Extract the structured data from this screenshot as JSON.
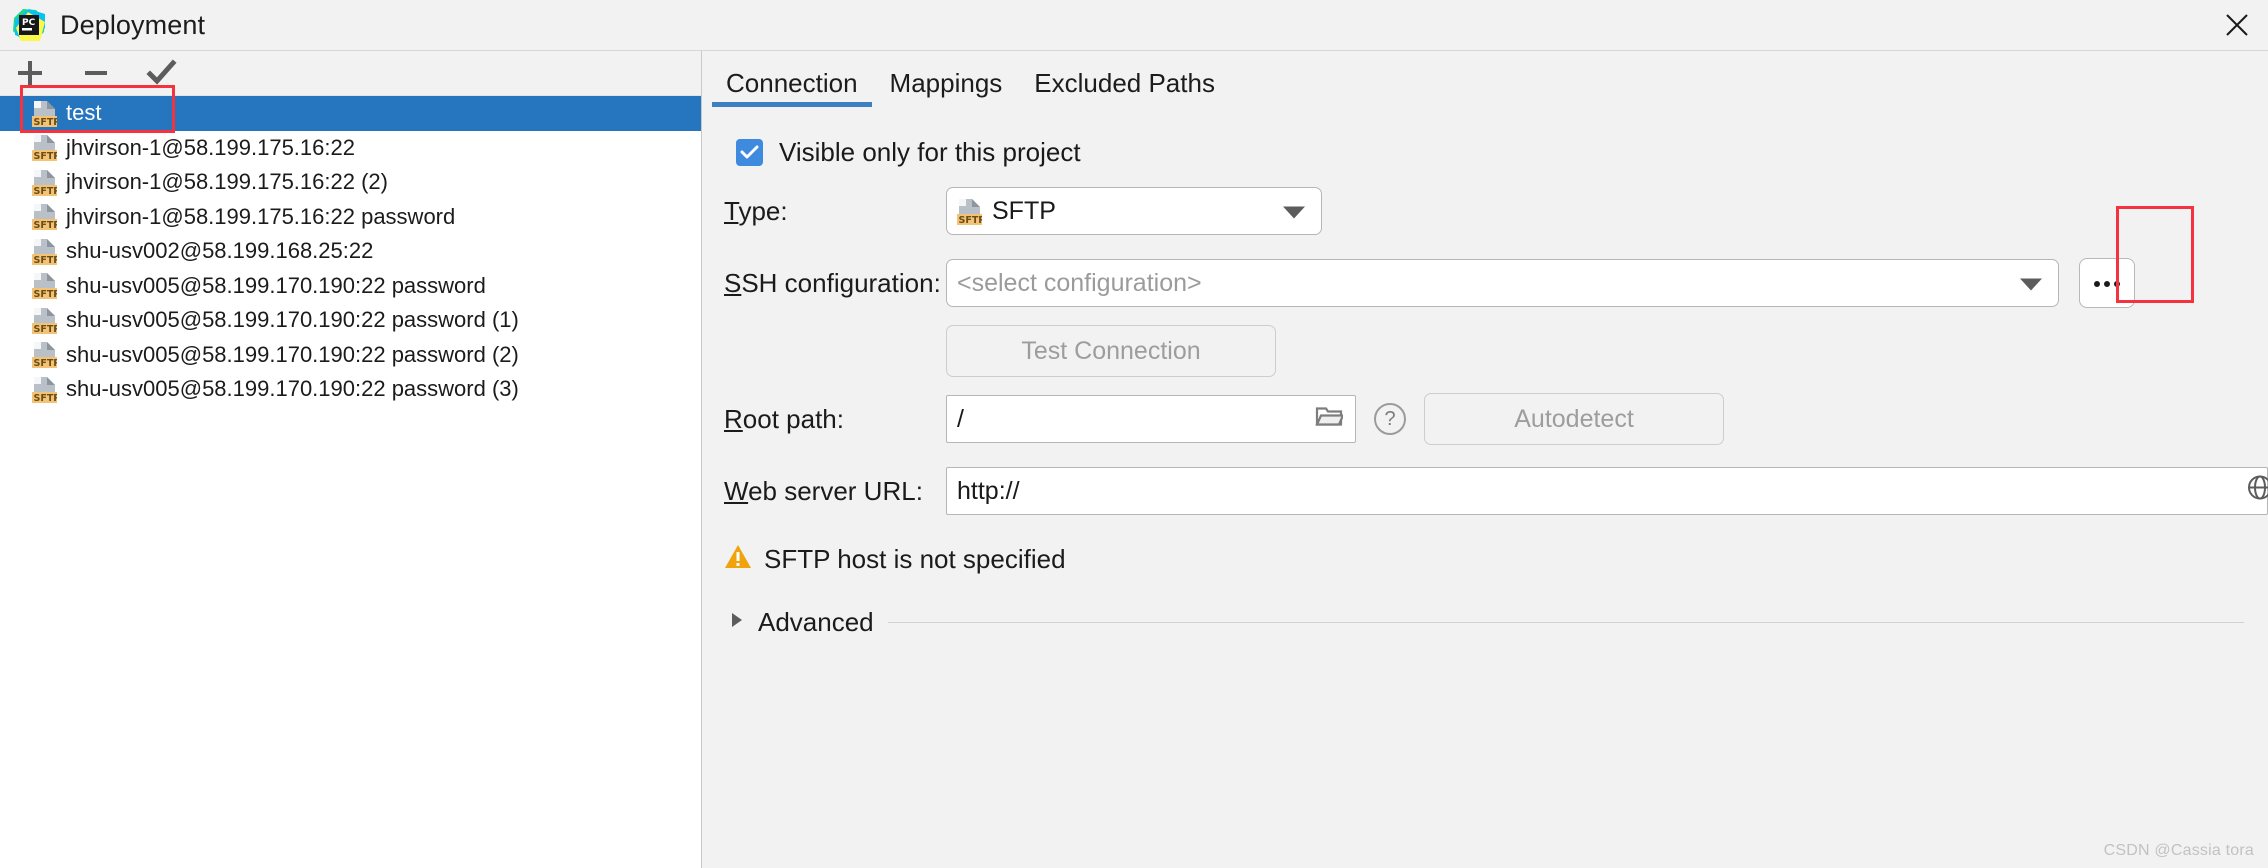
{
  "window": {
    "title": "Deployment",
    "logo_icon": "pycharm-logo-icon",
    "close_icon": "close-icon"
  },
  "toolbar": {
    "add_label": "+",
    "remove_label": "−",
    "apply_label": "✓",
    "add_icon": "plus-icon",
    "remove_icon": "minus-icon",
    "apply_icon": "checkmark-icon"
  },
  "server_list": {
    "icon": "sftp-file-icon",
    "icon_badge": "SFTP",
    "selected_index": 0,
    "items": [
      {
        "label": "test",
        "selected": true
      },
      {
        "label": "jhvirson-1@58.199.175.16:22",
        "selected": false
      },
      {
        "label": "jhvirson-1@58.199.175.16:22 (2)",
        "selected": false
      },
      {
        "label": "jhvirson-1@58.199.175.16:22 password",
        "selected": false
      },
      {
        "label": "shu-usv002@58.199.168.25:22",
        "selected": false
      },
      {
        "label": "shu-usv005@58.199.170.190:22 password",
        "selected": false
      },
      {
        "label": "shu-usv005@58.199.170.190:22 password (1)",
        "selected": false
      },
      {
        "label": "shu-usv005@58.199.170.190:22 password (2)",
        "selected": false
      },
      {
        "label": "shu-usv005@58.199.170.190:22 password (3)",
        "selected": false
      }
    ]
  },
  "tabs": [
    {
      "label": "Connection",
      "active": true
    },
    {
      "label": "Mappings",
      "active": false
    },
    {
      "label": "Excluded Paths",
      "active": false
    }
  ],
  "connection": {
    "visible_only_checkbox": {
      "label": "Visible only for this project",
      "checked": true
    },
    "type": {
      "label": "Type:",
      "mnemonic": "T",
      "value": "SFTP",
      "icon": "sftp-file-icon"
    },
    "ssh_configuration": {
      "label": "SSH configuration:",
      "mnemonic": "S",
      "placeholder": "<select configuration>",
      "value": "",
      "browse_button_label": "...",
      "browse_icon": "ellipsis-icon"
    },
    "test_connection_button": {
      "label": "Test Connection",
      "enabled": false
    },
    "root_path": {
      "label": "Root path:",
      "mnemonic": "R",
      "value": "/",
      "browse_icon": "folder-icon",
      "help_icon": "question-mark-icon",
      "autodetect_button": {
        "label": "Autodetect",
        "enabled": false
      }
    },
    "web_server_url": {
      "label": "Web server URL:",
      "mnemonic": "W",
      "value": "http://",
      "trailing_icon": "globe-icon"
    },
    "warning": {
      "text": "SFTP host is not specified",
      "icon": "warning-triangle-icon"
    },
    "advanced": {
      "label": "Advanced",
      "expanded": false,
      "icon": "chevron-right-icon"
    }
  },
  "highlights": {
    "selected_item_box_color": "#f5333f",
    "browse_button_box_color": "#f5333f"
  },
  "theme": {
    "selection_blue": "#2675bf",
    "tab_underline": "#3e7fc1",
    "checkbox_blue": "#3d8ade",
    "warning_amber": "#f0a30a",
    "sftp_badge": "#f2c277"
  },
  "watermark": {
    "text": "CSDN @Cassia tora"
  }
}
